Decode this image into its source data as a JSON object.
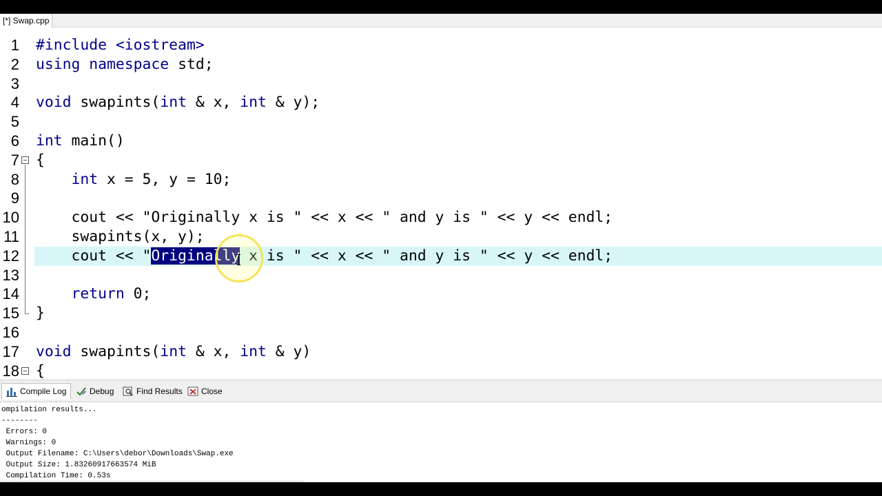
{
  "tab": {
    "label": "[*] Swap.cpp"
  },
  "editor": {
    "lines": [
      {
        "n": "1",
        "tokens": [
          {
            "t": "#include <iostream>",
            "k": "kw"
          }
        ]
      },
      {
        "n": "2",
        "tokens": [
          {
            "t": "using namespace",
            "k": "kw"
          },
          {
            "t": " std;"
          }
        ]
      },
      {
        "n": "3",
        "tokens": []
      },
      {
        "n": "4",
        "tokens": [
          {
            "t": "void",
            "k": "kw"
          },
          {
            "t": " swapints("
          },
          {
            "t": "int",
            "k": "kw"
          },
          {
            "t": " & x, "
          },
          {
            "t": "int",
            "k": "kw"
          },
          {
            "t": " & y);"
          }
        ]
      },
      {
        "n": "5",
        "tokens": []
      },
      {
        "n": "6",
        "tokens": [
          {
            "t": "int",
            "k": "kw"
          },
          {
            "t": " main()"
          }
        ]
      },
      {
        "n": "7",
        "tokens": [
          {
            "t": "{"
          }
        ]
      },
      {
        "n": "8",
        "tokens": [
          {
            "t": "    "
          },
          {
            "t": "int",
            "k": "kw"
          },
          {
            "t": " x = 5, y = 10;"
          }
        ]
      },
      {
        "n": "9",
        "tokens": []
      },
      {
        "n": "10",
        "tokens": [
          {
            "t": "    cout << \"Originally x is \" << x << \" and y is \" << y << endl;"
          }
        ]
      },
      {
        "n": "11",
        "tokens": [
          {
            "t": "    swapints(x, y);"
          }
        ]
      },
      {
        "n": "12",
        "tokens": [
          {
            "t": "    cout << \""
          },
          {
            "t": "Originally",
            "k": "sel"
          },
          {
            "t": " x is \" << x << \" and y is \" << y << endl;"
          }
        ]
      },
      {
        "n": "13",
        "tokens": []
      },
      {
        "n": "14",
        "tokens": [
          {
            "t": "    "
          },
          {
            "t": "return",
            "k": "kw"
          },
          {
            "t": " 0;"
          }
        ]
      },
      {
        "n": "15",
        "tokens": [
          {
            "t": "}"
          }
        ]
      },
      {
        "n": "16",
        "tokens": []
      },
      {
        "n": "17",
        "tokens": [
          {
            "t": "void",
            "k": "kw"
          },
          {
            "t": " swapints("
          },
          {
            "t": "int",
            "k": "kw"
          },
          {
            "t": " & x, "
          },
          {
            "t": "int",
            "k": "kw"
          },
          {
            "t": " & y)"
          }
        ]
      },
      {
        "n": "18",
        "tokens": [
          {
            "t": "{"
          }
        ]
      }
    ],
    "current_line": "12",
    "selected_text": "Originally"
  },
  "bottom_tabs": [
    {
      "label": "Compile Log",
      "icon": "bar-chart-icon",
      "active": true
    },
    {
      "label": "Debug",
      "icon": "check-pencil-icon",
      "active": false
    },
    {
      "label": "Find Results",
      "icon": "find-icon",
      "active": false
    },
    {
      "label": "Close",
      "icon": "close-icon",
      "active": false
    }
  ],
  "compile_log": [
    "ompilation results...",
    "--------",
    " Errors: 0",
    " Warnings: 0",
    " Output Filename: C:\\Users\\debor\\Downloads\\Swap.exe",
    " Output Size: 1.83260917663574 MiB",
    " Compilation Time: 0.53s"
  ]
}
